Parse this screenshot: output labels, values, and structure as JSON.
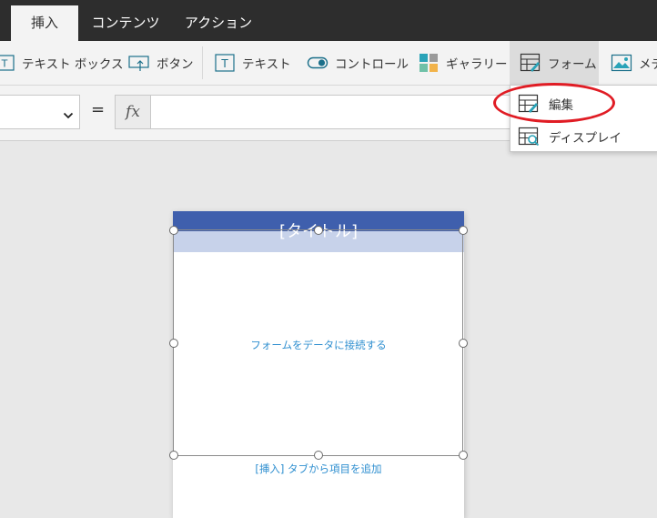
{
  "tabs": [
    {
      "label": "挿入",
      "active": true
    },
    {
      "label": "コンテンツ",
      "active": false
    },
    {
      "label": "アクション",
      "active": false
    }
  ],
  "ribbon": {
    "textbox": "テキスト ボックス",
    "button": "ボタン",
    "text": "テキスト",
    "control": "コントロール",
    "gallery": "ギャラリー",
    "form": "フォーム",
    "media": "メデ"
  },
  "formula": {
    "equals": "=",
    "fx": "fx",
    "value": ""
  },
  "form_menu": {
    "items": [
      {
        "label": "編集",
        "icon": "form-edit-icon"
      },
      {
        "label": "ディスプレイ",
        "icon": "form-display-icon"
      }
    ]
  },
  "canvas": {
    "title": "[タイトル]",
    "connect_text": "フォームをデータに接続する",
    "hint_text": "[挿入] タブから項目を追加"
  },
  "colors": {
    "title_bar": "#3f5fad",
    "accent_link": "#2f8fd0",
    "highlight_circle": "#e01c24"
  }
}
